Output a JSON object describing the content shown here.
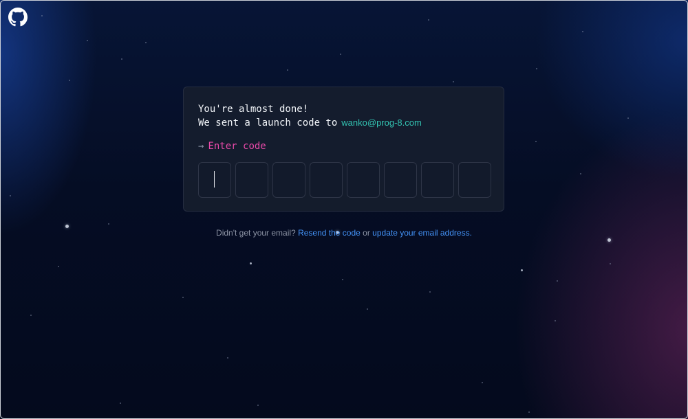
{
  "logo": {
    "icon": "github-icon",
    "alt": "GitHub"
  },
  "card": {
    "line1": "You're almost done!",
    "line2_prefix": "We sent a launch code to",
    "email": "wanko@prog-8.com",
    "prompt_arrow": "→",
    "prompt_label": "Enter code",
    "code_boxes": [
      "",
      "",
      "",
      "",
      "",
      "",
      "",
      ""
    ]
  },
  "footer": {
    "question": "Didn't get your email?",
    "resend_link": "Resend the code",
    "or_text": "or",
    "update_link": "update your email address",
    "period": "."
  },
  "colors": {
    "background": "#050c20",
    "card_bg": "#161d2e",
    "email": "#33c3b2",
    "prompt": "#ea4aaa",
    "link": "#4493f8"
  }
}
